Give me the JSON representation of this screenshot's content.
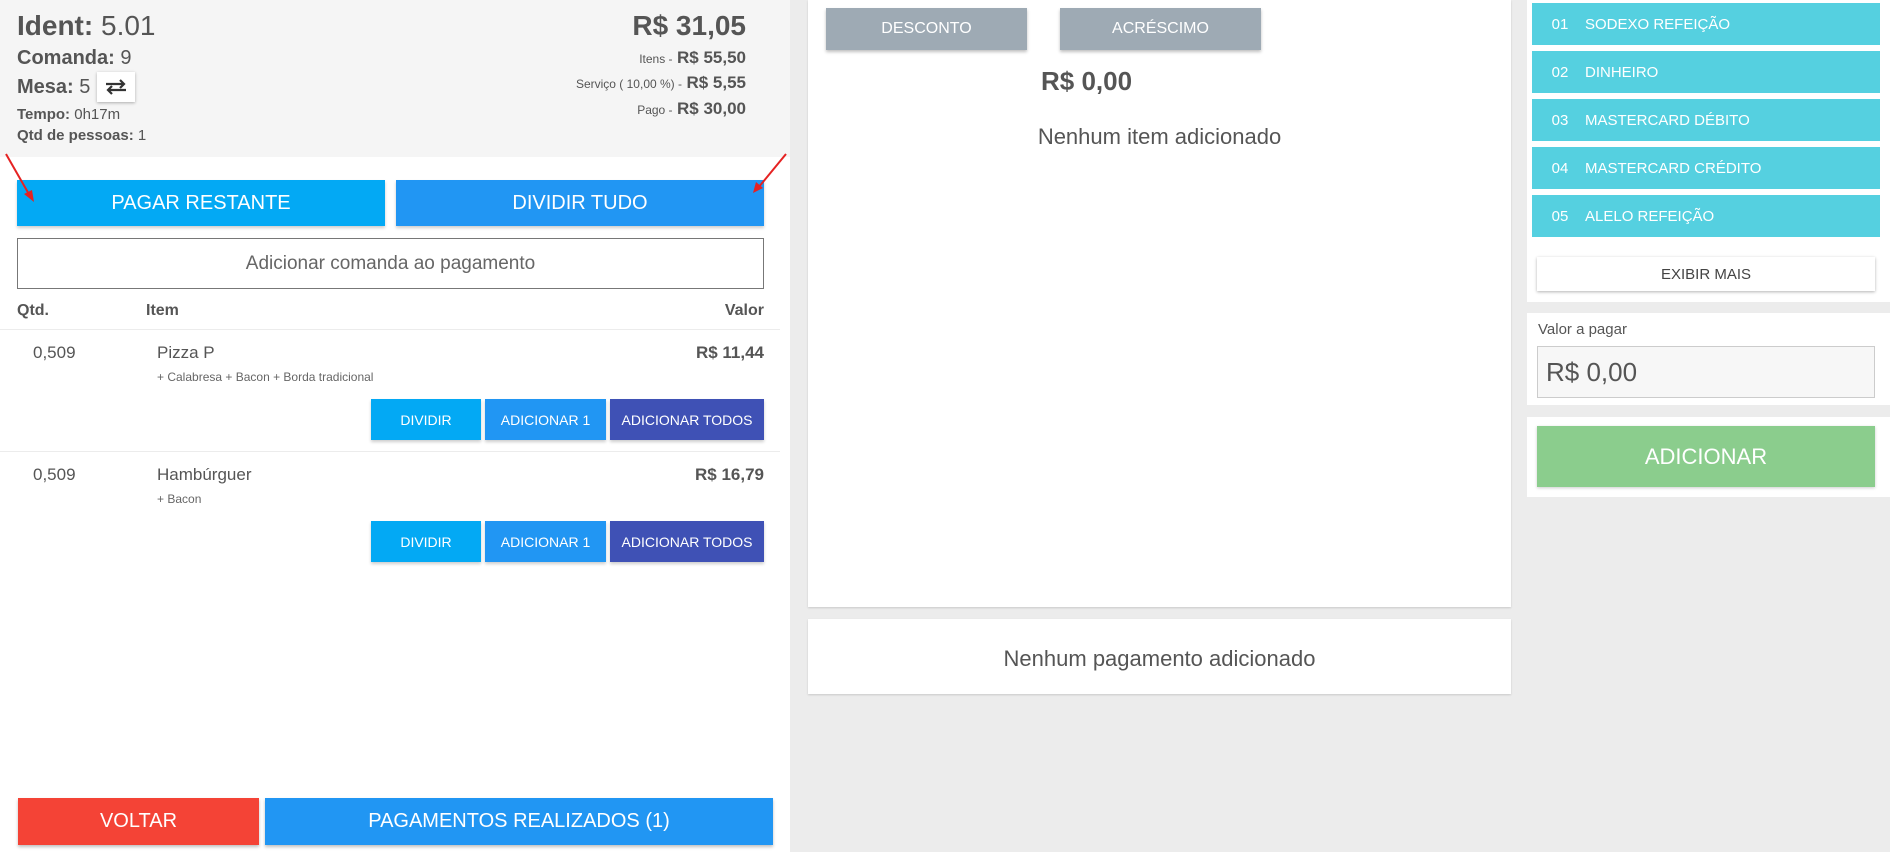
{
  "summary": {
    "ident_label": "Ident:",
    "ident_value": "5.01",
    "comanda_label": "Comanda:",
    "comanda_value": "9",
    "mesa_label": "Mesa:",
    "mesa_value": "5",
    "tempo_label": "Tempo:",
    "tempo_value": "0h17m",
    "pessoas_label": "Qtd de pessoas:",
    "pessoas_value": "1",
    "total": "R$ 31,05",
    "itens_label": "Itens -",
    "itens_value": "R$ 55,50",
    "servico_label": "Serviço ( 10,00 %) -",
    "servico_value": "R$ 5,55",
    "pago_label": "Pago -",
    "pago_value": "R$ 30,00"
  },
  "actions": {
    "pagar_restante": "PAGAR RESTANTE",
    "dividir_tudo": "DIVIDIR TUDO",
    "add_comanda": "Adicionar comanda ao pagamento"
  },
  "table": {
    "headers": {
      "qtd": "Qtd.",
      "item": "Item",
      "valor": "Valor"
    },
    "rows": [
      {
        "qtd": "0,509",
        "name": "Pizza P",
        "addons": "+ Calabresa  + Bacon  + Borda tradicional",
        "value": "R$ 11,44"
      },
      {
        "qtd": "0,509",
        "name": "Hambúrguer",
        "addons": "+ Bacon",
        "value": "R$ 16,79"
      }
    ],
    "row_buttons": {
      "dividir": "DIVIDIR",
      "adicionar_1": "ADICIONAR 1",
      "adicionar_todos": "ADICIONAR TODOS"
    }
  },
  "footer": {
    "voltar": "VOLTAR",
    "pagamentos": "PAGAMENTOS REALIZADOS (1)"
  },
  "middle": {
    "desconto": "DESCONTO",
    "acrescimo": "ACRÉSCIMO",
    "valor": "R$ 0,00",
    "nenhum_item": "Nenhum item adicionado",
    "nenhum_pagamento": "Nenhum pagamento adicionado"
  },
  "payment_methods": [
    {
      "code": "01",
      "label": "SODEXO REFEIÇÃO"
    },
    {
      "code": "02",
      "label": "DINHEIRO"
    },
    {
      "code": "03",
      "label": "MASTERCARD DÉBITO"
    },
    {
      "code": "04",
      "label": "MASTERCARD CRÉDITO"
    },
    {
      "code": "05",
      "label": "ALELO REFEIÇÃO"
    }
  ],
  "right": {
    "exibir_mais": "EXIBIR MAIS",
    "valor_label": "Valor a pagar",
    "valor_input": "R$ 0,00",
    "adicionar": "ADICIONAR"
  },
  "colors": {
    "primary_light": "#03a9f4",
    "primary": "#2196f3",
    "indigo": "#3f51b5",
    "danger": "#f44336",
    "payment_method": "#55d0e0",
    "success_disabled": "#8bcd8d",
    "neutral_button": "#9eaab4"
  }
}
